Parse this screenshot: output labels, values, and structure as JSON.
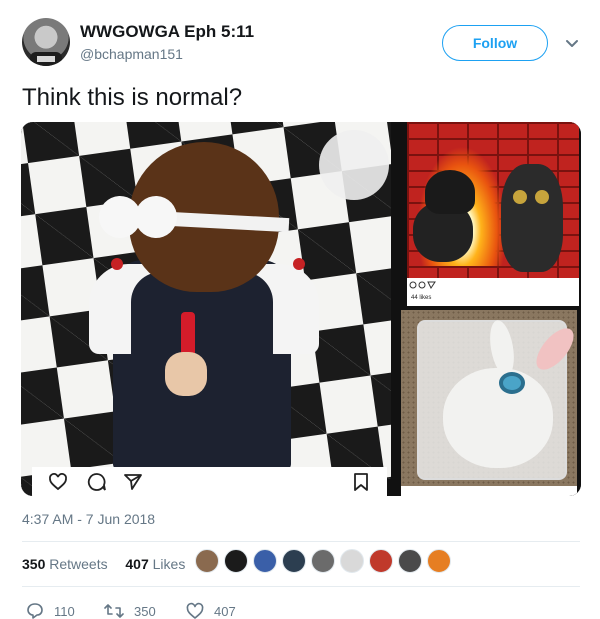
{
  "user": {
    "display_name": "WWGOWGA Eph 5:11",
    "handle": "@bchapman151",
    "follow_label": "Follow"
  },
  "tweet": {
    "text": "Think this is normal?",
    "timestamp": "4:37 AM - 7 Jun 2018"
  },
  "media": {
    "top_right_likes": "44 likes"
  },
  "stats": {
    "retweets_count": "350",
    "retweets_label": "Retweets",
    "likes_count": "407",
    "likes_label": "Likes",
    "liker_colors": [
      "#8a6a4f",
      "#1b1b1b",
      "#3a5fa8",
      "#2c3e50",
      "#6b6b6b",
      "#d9d9d9",
      "#c0392b",
      "#4a4a4a",
      "#e67e22"
    ]
  },
  "actions": {
    "reply_count": "110",
    "retweet_count": "350",
    "like_count": "407"
  },
  "colors": {
    "accent": "#1da1f2",
    "muted": "#657786",
    "text": "#14171a"
  }
}
